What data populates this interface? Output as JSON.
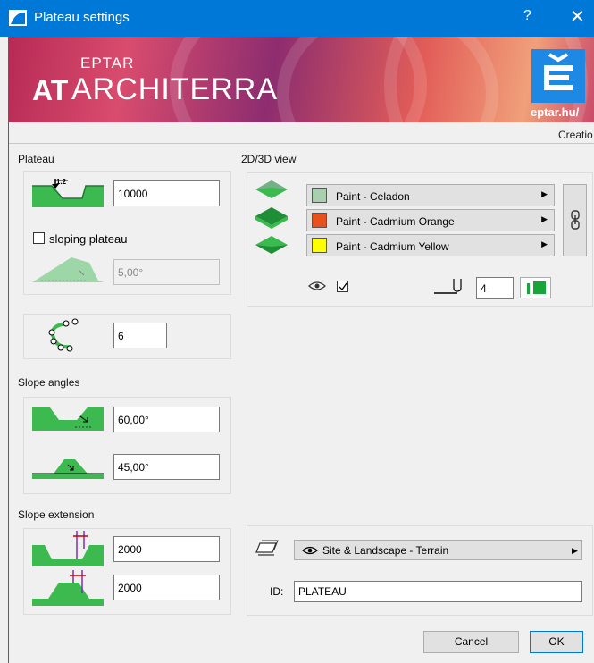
{
  "window": {
    "title": "Plateau settings",
    "help": "?",
    "close": "✕"
  },
  "banner": {
    "eptar": "EPTAR",
    "architerra": "ARCHITERRA",
    "at": "AT",
    "site": "eptar.hu/"
  },
  "creation_tab": "Creatio",
  "plateau": {
    "label": "Plateau",
    "height_value": "10000",
    "height_badge": "1.2",
    "sloping_label": "sloping plateau",
    "sloping_checked": false,
    "slope_value": "5,00°",
    "segments_value": "6"
  },
  "slope_angles": {
    "label": "Slope angles",
    "angle1": "60,00°",
    "angle2": "45,00°"
  },
  "slope_extension": {
    "label": "Slope extension",
    "ext1": "2000",
    "ext2": "2000"
  },
  "view": {
    "label": "2D/3D view",
    "materials": [
      {
        "name": "Paint - Celadon",
        "color": "#a8cfae"
      },
      {
        "name": "Paint - Cadmium Orange",
        "color": "#e8501c"
      },
      {
        "name": "Paint - Cadmium Yellow",
        "color": "#ffff00"
      }
    ],
    "visible_checked": true,
    "pen_value": "4"
  },
  "layer": {
    "name": "Site & Landscape - Terrain"
  },
  "id": {
    "label": "ID:",
    "value": "PLATEAU"
  },
  "buttons": {
    "cancel": "Cancel",
    "ok": "OK"
  },
  "colors": {
    "titlebar": "#0078d7",
    "green": "#3cb94f"
  }
}
